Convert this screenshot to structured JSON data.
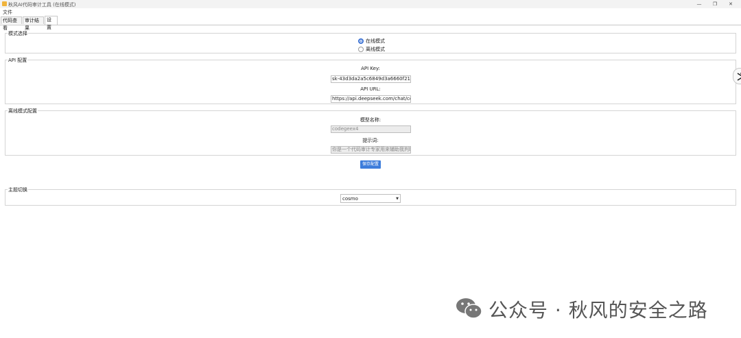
{
  "window": {
    "title": "秋风AI代码审计工具 (在线模式)",
    "controls": [
      "—",
      "❐",
      "✕"
    ]
  },
  "menu": {
    "file": "文件"
  },
  "tabs": [
    {
      "label": "代码查看",
      "active": false
    },
    {
      "label": "审计结果",
      "active": false
    },
    {
      "label": "设置",
      "active": true
    }
  ],
  "mode_group": {
    "legend": "模式选择",
    "options": [
      {
        "label": "在线模式",
        "checked": true
      },
      {
        "label": "离线模式",
        "checked": false
      }
    ]
  },
  "api_group": {
    "legend": "API 配置",
    "key_label": "API Key:",
    "key_value": "sk-43d3da2a5c6849d3a6660f21990d",
    "url_label": "API URL:",
    "url_value": "https://api.deepseek.com/chat/comp"
  },
  "offline_group": {
    "legend": "离线模式配置",
    "model_label": "模型名称:",
    "model_value": "codegeex4",
    "prompt_label": "提示词:",
    "prompt_value": "你是一个代码审计专家用来辅助我判断代"
  },
  "save_button": "保存配置",
  "theme_group": {
    "legend": "主题切换",
    "selected": "cosmo"
  },
  "watermark": {
    "text": "公众号 · 秋风的安全之路"
  },
  "colors": {
    "accent": "#3d7ddb",
    "radio_checked": "#3d73d4"
  }
}
